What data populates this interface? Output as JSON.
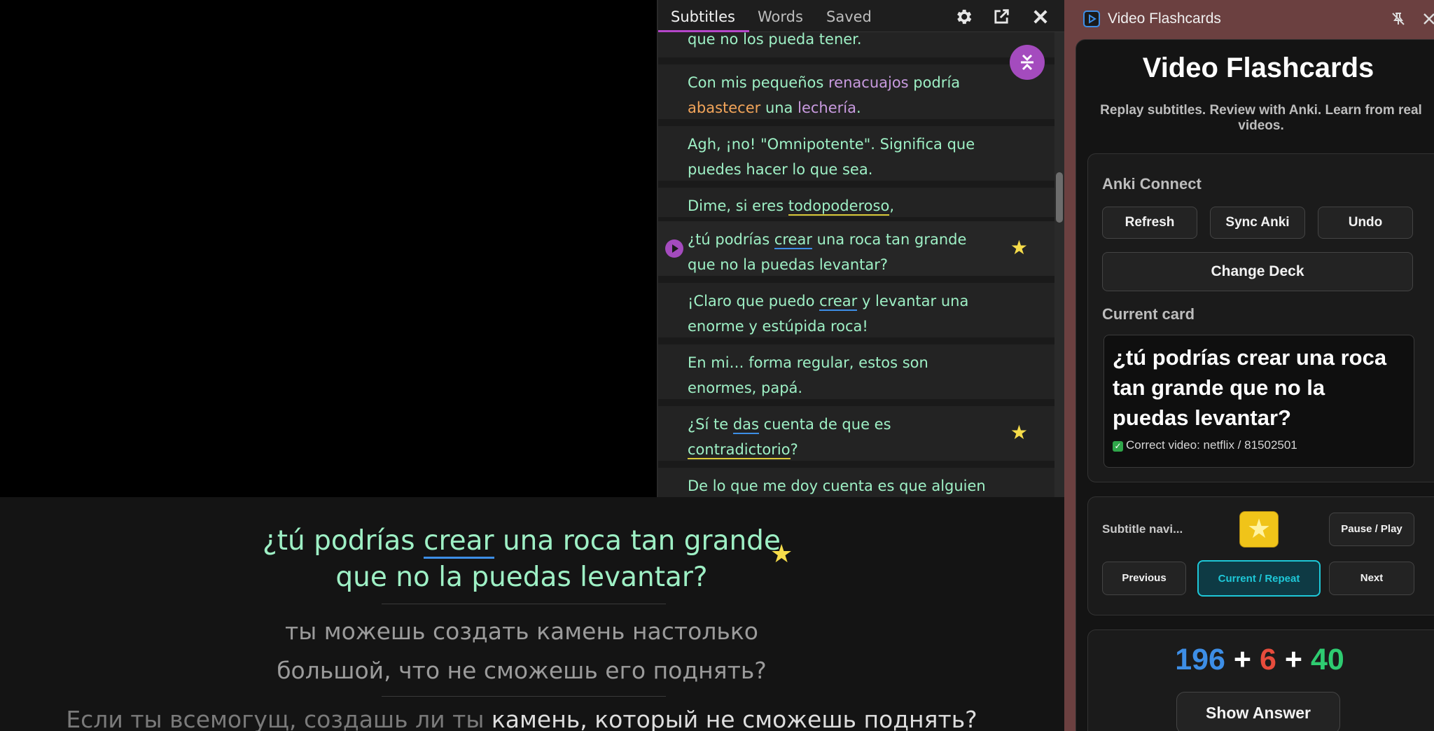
{
  "panel": {
    "tabs": [
      "Subtitles",
      "Words",
      "Saved"
    ],
    "icons": [
      "gear-icon",
      "export-icon",
      "close-icon"
    ],
    "rows": {
      "r0": "que no los pueda tener.",
      "r1_a": "Con mis pequeños ",
      "r1_b": "renacuajos",
      "r1_c": " podría",
      "r1_d": "abastecer",
      "r1_e": " una ",
      "r1_f": "lechería",
      "r1_g": ".",
      "r2": "Agh, ¡no! \"Omnipotente\". Significa que puedes hacer lo que sea.",
      "r3_a": "Dime, si eres ",
      "r3_b": "todopoderoso",
      "r3_c": ",",
      "r4_a": "¿tú podrías ",
      "r4_b": "crear",
      "r4_c": " una roca tan grande que no la puedas levantar?",
      "r5_a": "¡Claro que puedo ",
      "r5_b": "crear",
      "r5_c": " y levantar una enorme y estúpida roca!",
      "r6": "En mi… forma regular, estos son enormes, papá.",
      "r7_a": "¿Sí te ",
      "r7_b": "das",
      "r7_c": " cuenta de que es ",
      "r7_d": "contradictorio",
      "r7_e": "?",
      "r8": "De lo que me doy cuenta es que alguien de"
    },
    "star": "★"
  },
  "player": {
    "cue1_a": "¿tú podrías ",
    "cue1_b": "crear",
    "cue1_c": " una roca tan grande",
    "cue1_d": "que no la puedas levantar?",
    "star": "★",
    "cue2_l1": "ты можешь создать камень настолько",
    "cue2_l2": "большой, что не сможешь его поднять?",
    "cue3_a": "Если ты всемогущ, создашь ли ты ",
    "cue3_b": "камень, который не сможешь поднять?"
  },
  "ext": {
    "window_title": "Video Flashcards",
    "title": "Video Flashcards",
    "tagline": "Replay subtitles. Review with Anki. Learn from real videos.",
    "anki_header": "Anki Connect",
    "refresh": "Refresh",
    "sync": "Sync Anki",
    "undo": "Undo",
    "change_deck": "Change Deck",
    "current_header": "Current card",
    "card_text": "¿tú podrías crear una roca tan grande que no la puedas levantar?",
    "card_meta": "Correct video: netflix / 81502501",
    "nav_label": "Subtitle navi...",
    "pause_play": "Pause / Play",
    "previous": "Previous",
    "current_repeat": "Current / Repeat",
    "next": "Next",
    "count_new": "196",
    "count_learn": "6",
    "count_review": "40",
    "plus": "+",
    "show_answer": "Show Answer",
    "accent": "#1ec8d8"
  }
}
